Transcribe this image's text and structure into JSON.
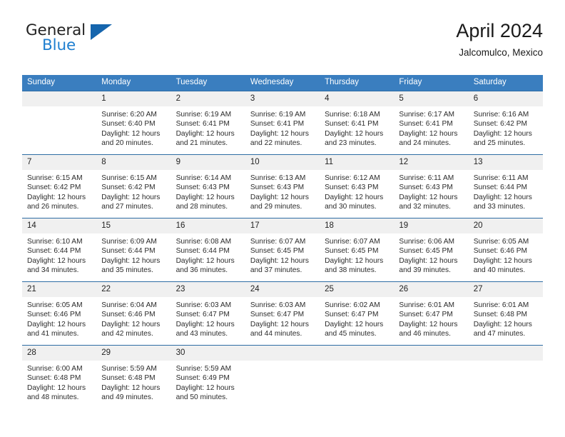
{
  "brand": {
    "word_top": "General",
    "word_bottom": "Blue",
    "triangle_color": "#1565ad",
    "blue_color": "#1f7fd0"
  },
  "header": {
    "title": "April 2024",
    "subtitle": "Jalcomulco, Mexico"
  },
  "theme": {
    "header_blue": "#3a7ebf",
    "row_border_blue": "#2e6da4",
    "daynum_strip": "#f0f0f0"
  },
  "calendar": {
    "weekday_headers": [
      "Sunday",
      "Monday",
      "Tuesday",
      "Wednesday",
      "Thursday",
      "Friday",
      "Saturday"
    ],
    "labels": {
      "sunrise": "Sunrise:",
      "sunset": "Sunset:",
      "daylight": "Daylight:"
    },
    "weeks": [
      [
        {
          "day": "",
          "sunrise": "",
          "sunset": "",
          "daylight_line1": "",
          "daylight_line2": ""
        },
        {
          "day": "1",
          "sunrise": "Sunrise: 6:20 AM",
          "sunset": "Sunset: 6:40 PM",
          "daylight_line1": "Daylight: 12 hours",
          "daylight_line2": "and 20 minutes."
        },
        {
          "day": "2",
          "sunrise": "Sunrise: 6:19 AM",
          "sunset": "Sunset: 6:41 PM",
          "daylight_line1": "Daylight: 12 hours",
          "daylight_line2": "and 21 minutes."
        },
        {
          "day": "3",
          "sunrise": "Sunrise: 6:19 AM",
          "sunset": "Sunset: 6:41 PM",
          "daylight_line1": "Daylight: 12 hours",
          "daylight_line2": "and 22 minutes."
        },
        {
          "day": "4",
          "sunrise": "Sunrise: 6:18 AM",
          "sunset": "Sunset: 6:41 PM",
          "daylight_line1": "Daylight: 12 hours",
          "daylight_line2": "and 23 minutes."
        },
        {
          "day": "5",
          "sunrise": "Sunrise: 6:17 AM",
          "sunset": "Sunset: 6:41 PM",
          "daylight_line1": "Daylight: 12 hours",
          "daylight_line2": "and 24 minutes."
        },
        {
          "day": "6",
          "sunrise": "Sunrise: 6:16 AM",
          "sunset": "Sunset: 6:42 PM",
          "daylight_line1": "Daylight: 12 hours",
          "daylight_line2": "and 25 minutes."
        }
      ],
      [
        {
          "day": "7",
          "sunrise": "Sunrise: 6:15 AM",
          "sunset": "Sunset: 6:42 PM",
          "daylight_line1": "Daylight: 12 hours",
          "daylight_line2": "and 26 minutes."
        },
        {
          "day": "8",
          "sunrise": "Sunrise: 6:15 AM",
          "sunset": "Sunset: 6:42 PM",
          "daylight_line1": "Daylight: 12 hours",
          "daylight_line2": "and 27 minutes."
        },
        {
          "day": "9",
          "sunrise": "Sunrise: 6:14 AM",
          "sunset": "Sunset: 6:43 PM",
          "daylight_line1": "Daylight: 12 hours",
          "daylight_line2": "and 28 minutes."
        },
        {
          "day": "10",
          "sunrise": "Sunrise: 6:13 AM",
          "sunset": "Sunset: 6:43 PM",
          "daylight_line1": "Daylight: 12 hours",
          "daylight_line2": "and 29 minutes."
        },
        {
          "day": "11",
          "sunrise": "Sunrise: 6:12 AM",
          "sunset": "Sunset: 6:43 PM",
          "daylight_line1": "Daylight: 12 hours",
          "daylight_line2": "and 30 minutes."
        },
        {
          "day": "12",
          "sunrise": "Sunrise: 6:11 AM",
          "sunset": "Sunset: 6:43 PM",
          "daylight_line1": "Daylight: 12 hours",
          "daylight_line2": "and 32 minutes."
        },
        {
          "day": "13",
          "sunrise": "Sunrise: 6:11 AM",
          "sunset": "Sunset: 6:44 PM",
          "daylight_line1": "Daylight: 12 hours",
          "daylight_line2": "and 33 minutes."
        }
      ],
      [
        {
          "day": "14",
          "sunrise": "Sunrise: 6:10 AM",
          "sunset": "Sunset: 6:44 PM",
          "daylight_line1": "Daylight: 12 hours",
          "daylight_line2": "and 34 minutes."
        },
        {
          "day": "15",
          "sunrise": "Sunrise: 6:09 AM",
          "sunset": "Sunset: 6:44 PM",
          "daylight_line1": "Daylight: 12 hours",
          "daylight_line2": "and 35 minutes."
        },
        {
          "day": "16",
          "sunrise": "Sunrise: 6:08 AM",
          "sunset": "Sunset: 6:44 PM",
          "daylight_line1": "Daylight: 12 hours",
          "daylight_line2": "and 36 minutes."
        },
        {
          "day": "17",
          "sunrise": "Sunrise: 6:07 AM",
          "sunset": "Sunset: 6:45 PM",
          "daylight_line1": "Daylight: 12 hours",
          "daylight_line2": "and 37 minutes."
        },
        {
          "day": "18",
          "sunrise": "Sunrise: 6:07 AM",
          "sunset": "Sunset: 6:45 PM",
          "daylight_line1": "Daylight: 12 hours",
          "daylight_line2": "and 38 minutes."
        },
        {
          "day": "19",
          "sunrise": "Sunrise: 6:06 AM",
          "sunset": "Sunset: 6:45 PM",
          "daylight_line1": "Daylight: 12 hours",
          "daylight_line2": "and 39 minutes."
        },
        {
          "day": "20",
          "sunrise": "Sunrise: 6:05 AM",
          "sunset": "Sunset: 6:46 PM",
          "daylight_line1": "Daylight: 12 hours",
          "daylight_line2": "and 40 minutes."
        }
      ],
      [
        {
          "day": "21",
          "sunrise": "Sunrise: 6:05 AM",
          "sunset": "Sunset: 6:46 PM",
          "daylight_line1": "Daylight: 12 hours",
          "daylight_line2": "and 41 minutes."
        },
        {
          "day": "22",
          "sunrise": "Sunrise: 6:04 AM",
          "sunset": "Sunset: 6:46 PM",
          "daylight_line1": "Daylight: 12 hours",
          "daylight_line2": "and 42 minutes."
        },
        {
          "day": "23",
          "sunrise": "Sunrise: 6:03 AM",
          "sunset": "Sunset: 6:47 PM",
          "daylight_line1": "Daylight: 12 hours",
          "daylight_line2": "and 43 minutes."
        },
        {
          "day": "24",
          "sunrise": "Sunrise: 6:03 AM",
          "sunset": "Sunset: 6:47 PM",
          "daylight_line1": "Daylight: 12 hours",
          "daylight_line2": "and 44 minutes."
        },
        {
          "day": "25",
          "sunrise": "Sunrise: 6:02 AM",
          "sunset": "Sunset: 6:47 PM",
          "daylight_line1": "Daylight: 12 hours",
          "daylight_line2": "and 45 minutes."
        },
        {
          "day": "26",
          "sunrise": "Sunrise: 6:01 AM",
          "sunset": "Sunset: 6:47 PM",
          "daylight_line1": "Daylight: 12 hours",
          "daylight_line2": "and 46 minutes."
        },
        {
          "day": "27",
          "sunrise": "Sunrise: 6:01 AM",
          "sunset": "Sunset: 6:48 PM",
          "daylight_line1": "Daylight: 12 hours",
          "daylight_line2": "and 47 minutes."
        }
      ],
      [
        {
          "day": "28",
          "sunrise": "Sunrise: 6:00 AM",
          "sunset": "Sunset: 6:48 PM",
          "daylight_line1": "Daylight: 12 hours",
          "daylight_line2": "and 48 minutes."
        },
        {
          "day": "29",
          "sunrise": "Sunrise: 5:59 AM",
          "sunset": "Sunset: 6:48 PM",
          "daylight_line1": "Daylight: 12 hours",
          "daylight_line2": "and 49 minutes."
        },
        {
          "day": "30",
          "sunrise": "Sunrise: 5:59 AM",
          "sunset": "Sunset: 6:49 PM",
          "daylight_line1": "Daylight: 12 hours",
          "daylight_line2": "and 50 minutes."
        },
        {
          "day": "",
          "sunrise": "",
          "sunset": "",
          "daylight_line1": "",
          "daylight_line2": ""
        },
        {
          "day": "",
          "sunrise": "",
          "sunset": "",
          "daylight_line1": "",
          "daylight_line2": ""
        },
        {
          "day": "",
          "sunrise": "",
          "sunset": "",
          "daylight_line1": "",
          "daylight_line2": ""
        },
        {
          "day": "",
          "sunrise": "",
          "sunset": "",
          "daylight_line1": "",
          "daylight_line2": ""
        }
      ]
    ]
  }
}
